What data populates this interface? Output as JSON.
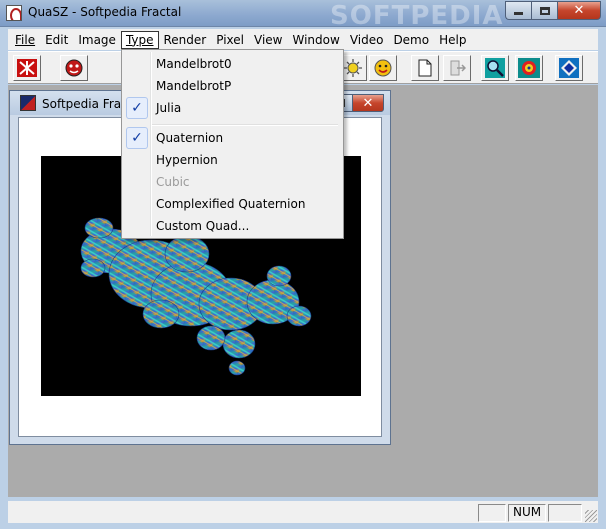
{
  "window": {
    "title": "QuaSZ - Softpedia Fractal",
    "watermark": "SOFTPEDIA"
  },
  "menu": {
    "items": [
      {
        "label": "File"
      },
      {
        "label": "Edit"
      },
      {
        "label": "Image"
      },
      {
        "label": "Type"
      },
      {
        "label": "Render"
      },
      {
        "label": "Pixel"
      },
      {
        "label": "View"
      },
      {
        "label": "Window"
      },
      {
        "label": "Video"
      },
      {
        "label": "Demo"
      },
      {
        "label": "Help"
      }
    ],
    "open_menu": "Type"
  },
  "toolbar": {
    "icons": [
      "red-star-icon",
      "red-face-icon",
      "sun-icon",
      "gear-smiley-icon",
      "new-document-icon",
      "exit-door-icon",
      "zoom-magnifier-icon",
      "palette-icon",
      "diamond-icon"
    ]
  },
  "child": {
    "title": "Softpedia Fractal"
  },
  "type_dropdown": {
    "items": [
      {
        "label": "Mandelbrot0",
        "checked": false,
        "enabled": true
      },
      {
        "label": "MandelbrotP",
        "checked": false,
        "enabled": true
      },
      {
        "label": "Julia",
        "checked": true,
        "enabled": true
      },
      {
        "label": "Quaternion",
        "checked": true,
        "enabled": true
      },
      {
        "label": "Hypernion",
        "checked": false,
        "enabled": true
      },
      {
        "label": "Cubic",
        "checked": false,
        "enabled": false
      },
      {
        "label": "Complexified Quaternion",
        "checked": false,
        "enabled": true
      },
      {
        "label": "Custom Quad...",
        "checked": false,
        "enabled": true
      }
    ]
  },
  "status": {
    "num_indicator": "NUM"
  },
  "colors": {
    "title_bar": "#8eaad0",
    "mdi_background": "#ababab",
    "menu_background": "#f0f0f0",
    "close_button": "#c6452c"
  }
}
